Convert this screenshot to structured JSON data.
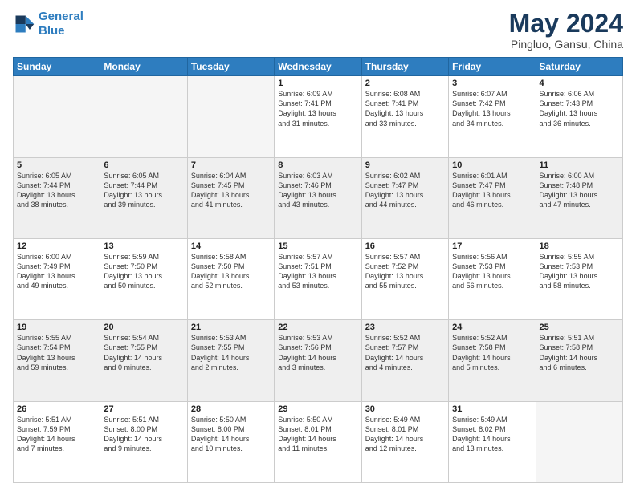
{
  "header": {
    "logo_line1": "General",
    "logo_line2": "Blue",
    "title": "May 2024",
    "subtitle": "Pingluo, Gansu, China"
  },
  "days_of_week": [
    "Sunday",
    "Monday",
    "Tuesday",
    "Wednesday",
    "Thursday",
    "Friday",
    "Saturday"
  ],
  "weeks": [
    {
      "days": [
        {
          "num": "",
          "info": ""
        },
        {
          "num": "",
          "info": ""
        },
        {
          "num": "",
          "info": ""
        },
        {
          "num": "1",
          "info": "Sunrise: 6:09 AM\nSunset: 7:41 PM\nDaylight: 13 hours\nand 31 minutes."
        },
        {
          "num": "2",
          "info": "Sunrise: 6:08 AM\nSunset: 7:41 PM\nDaylight: 13 hours\nand 33 minutes."
        },
        {
          "num": "3",
          "info": "Sunrise: 6:07 AM\nSunset: 7:42 PM\nDaylight: 13 hours\nand 34 minutes."
        },
        {
          "num": "4",
          "info": "Sunrise: 6:06 AM\nSunset: 7:43 PM\nDaylight: 13 hours\nand 36 minutes."
        }
      ]
    },
    {
      "days": [
        {
          "num": "5",
          "info": "Sunrise: 6:05 AM\nSunset: 7:44 PM\nDaylight: 13 hours\nand 38 minutes."
        },
        {
          "num": "6",
          "info": "Sunrise: 6:05 AM\nSunset: 7:44 PM\nDaylight: 13 hours\nand 39 minutes."
        },
        {
          "num": "7",
          "info": "Sunrise: 6:04 AM\nSunset: 7:45 PM\nDaylight: 13 hours\nand 41 minutes."
        },
        {
          "num": "8",
          "info": "Sunrise: 6:03 AM\nSunset: 7:46 PM\nDaylight: 13 hours\nand 43 minutes."
        },
        {
          "num": "9",
          "info": "Sunrise: 6:02 AM\nSunset: 7:47 PM\nDaylight: 13 hours\nand 44 minutes."
        },
        {
          "num": "10",
          "info": "Sunrise: 6:01 AM\nSunset: 7:47 PM\nDaylight: 13 hours\nand 46 minutes."
        },
        {
          "num": "11",
          "info": "Sunrise: 6:00 AM\nSunset: 7:48 PM\nDaylight: 13 hours\nand 47 minutes."
        }
      ]
    },
    {
      "days": [
        {
          "num": "12",
          "info": "Sunrise: 6:00 AM\nSunset: 7:49 PM\nDaylight: 13 hours\nand 49 minutes."
        },
        {
          "num": "13",
          "info": "Sunrise: 5:59 AM\nSunset: 7:50 PM\nDaylight: 13 hours\nand 50 minutes."
        },
        {
          "num": "14",
          "info": "Sunrise: 5:58 AM\nSunset: 7:50 PM\nDaylight: 13 hours\nand 52 minutes."
        },
        {
          "num": "15",
          "info": "Sunrise: 5:57 AM\nSunset: 7:51 PM\nDaylight: 13 hours\nand 53 minutes."
        },
        {
          "num": "16",
          "info": "Sunrise: 5:57 AM\nSunset: 7:52 PM\nDaylight: 13 hours\nand 55 minutes."
        },
        {
          "num": "17",
          "info": "Sunrise: 5:56 AM\nSunset: 7:53 PM\nDaylight: 13 hours\nand 56 minutes."
        },
        {
          "num": "18",
          "info": "Sunrise: 5:55 AM\nSunset: 7:53 PM\nDaylight: 13 hours\nand 58 minutes."
        }
      ]
    },
    {
      "days": [
        {
          "num": "19",
          "info": "Sunrise: 5:55 AM\nSunset: 7:54 PM\nDaylight: 13 hours\nand 59 minutes."
        },
        {
          "num": "20",
          "info": "Sunrise: 5:54 AM\nSunset: 7:55 PM\nDaylight: 14 hours\nand 0 minutes."
        },
        {
          "num": "21",
          "info": "Sunrise: 5:53 AM\nSunset: 7:55 PM\nDaylight: 14 hours\nand 2 minutes."
        },
        {
          "num": "22",
          "info": "Sunrise: 5:53 AM\nSunset: 7:56 PM\nDaylight: 14 hours\nand 3 minutes."
        },
        {
          "num": "23",
          "info": "Sunrise: 5:52 AM\nSunset: 7:57 PM\nDaylight: 14 hours\nand 4 minutes."
        },
        {
          "num": "24",
          "info": "Sunrise: 5:52 AM\nSunset: 7:58 PM\nDaylight: 14 hours\nand 5 minutes."
        },
        {
          "num": "25",
          "info": "Sunrise: 5:51 AM\nSunset: 7:58 PM\nDaylight: 14 hours\nand 6 minutes."
        }
      ]
    },
    {
      "days": [
        {
          "num": "26",
          "info": "Sunrise: 5:51 AM\nSunset: 7:59 PM\nDaylight: 14 hours\nand 7 minutes."
        },
        {
          "num": "27",
          "info": "Sunrise: 5:51 AM\nSunset: 8:00 PM\nDaylight: 14 hours\nand 9 minutes."
        },
        {
          "num": "28",
          "info": "Sunrise: 5:50 AM\nSunset: 8:00 PM\nDaylight: 14 hours\nand 10 minutes."
        },
        {
          "num": "29",
          "info": "Sunrise: 5:50 AM\nSunset: 8:01 PM\nDaylight: 14 hours\nand 11 minutes."
        },
        {
          "num": "30",
          "info": "Sunrise: 5:49 AM\nSunset: 8:01 PM\nDaylight: 14 hours\nand 12 minutes."
        },
        {
          "num": "31",
          "info": "Sunrise: 5:49 AM\nSunset: 8:02 PM\nDaylight: 14 hours\nand 13 minutes."
        },
        {
          "num": "",
          "info": ""
        }
      ]
    }
  ]
}
